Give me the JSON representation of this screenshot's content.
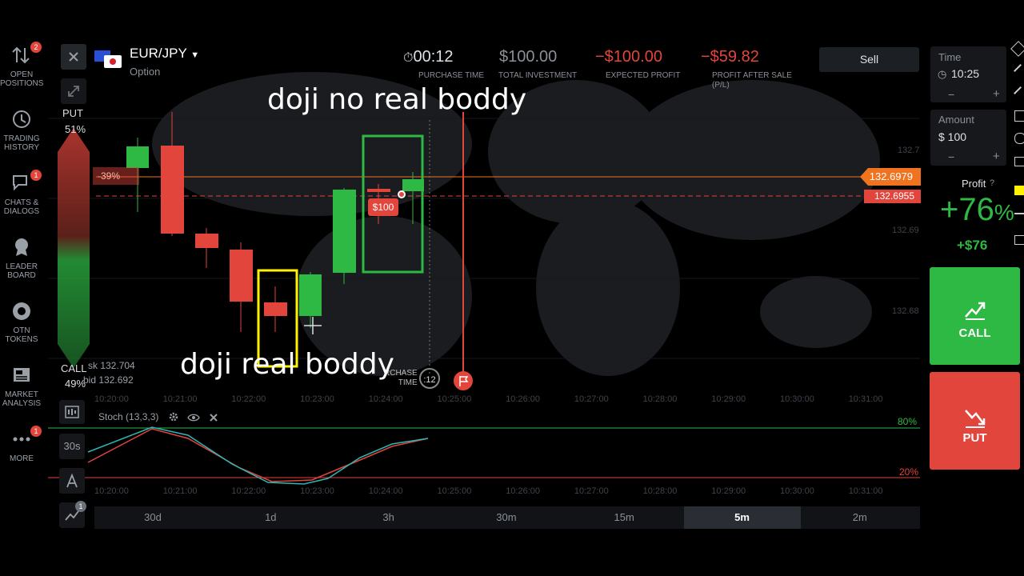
{
  "sidebar": {
    "items": [
      {
        "label_1": "OPEN",
        "label_2": "POSITIONS",
        "badge": "2",
        "icon": "open-positions-icon"
      },
      {
        "label_1": "TRADING",
        "label_2": "HISTORY",
        "icon": "history-icon"
      },
      {
        "label_1": "CHATS &",
        "label_2": "DIALOGS",
        "badge": "1",
        "icon": "chat-icon"
      },
      {
        "label_1": "LEADER",
        "label_2": "BOARD",
        "icon": "leaderboard-icon"
      },
      {
        "label_1": "OTN",
        "label_2": "TOKENS",
        "icon": "token-icon"
      },
      {
        "label_1": "MARKET",
        "label_2": "ANALYSIS",
        "icon": "news-icon"
      },
      {
        "label_1": "MORE",
        "label_2": "",
        "badge": "1",
        "icon": "more-icon"
      }
    ]
  },
  "asset": {
    "pair": "EUR/JPY",
    "type": "Option"
  },
  "sentiment": {
    "put_label": "PUT",
    "put_pct": "51%",
    "call_label": "CALL",
    "call_pct": "49%"
  },
  "top": {
    "timer": "00:12",
    "timer_label": "PURCHASE TIME",
    "investment": "$100.00",
    "investment_label": "TOTAL INVESTMENT",
    "expected": "−$100.00",
    "expected_label": "EXPECTED PROFIT",
    "after_sale": "−$59.82",
    "after_sale_label_1": "PROFIT AFTER SALE",
    "after_sale_label_2": "(P/L)",
    "sell_label": "Sell"
  },
  "right_panel": {
    "time_label": "Time",
    "time_value": "10:25",
    "amount_label": "Amount",
    "amount_value": "$ 100",
    "minus": "−",
    "plus": "+",
    "profit_label": "Profit",
    "profit_pct": "+76",
    "profit_pct_sign": "%",
    "profit_amount": "+$76",
    "call_label": "CALL",
    "put_label": "PUT"
  },
  "chart": {
    "price_current": "132.6979",
    "price_open": "132.6955",
    "y_ticks": [
      "132.7",
      "132.69",
      "132.68"
    ],
    "x_ticks": [
      "10:20:00",
      "10:21:00",
      "10:22:00",
      "10:23:00",
      "10:24:00",
      "10:25:00",
      "10:26:00",
      "10:27:00",
      "10:28:00",
      "10:29:00",
      "10:30:00",
      "10:31:00"
    ],
    "ask": "sk 132.704",
    "bid": "bid 132.692",
    "trade_marker": "$100",
    "loss_badge": "-39%",
    "purchase_time_1": "RCHASE",
    "purchase_time_2": "TIME",
    "countdown": ":12",
    "stoch_label": "Stoch (13,3,3)",
    "stoch_upper": "80%",
    "stoch_lower": "20%",
    "annotation_top": "doji no real boddy",
    "annotation_bottom": "doji real boddy"
  },
  "timeframes": [
    {
      "label": "30d"
    },
    {
      "label": "1d"
    },
    {
      "label": "3h"
    },
    {
      "label": "30m"
    },
    {
      "label": "15m"
    },
    {
      "label": "5m",
      "active": true
    },
    {
      "label": "2m"
    }
  ],
  "tools": {
    "interval": "30s",
    "badge": "1"
  },
  "colors": {
    "green": "#2eb844",
    "red": "#e2453c",
    "orange": "#f0731f",
    "accent_yellow": "#fff200"
  }
}
